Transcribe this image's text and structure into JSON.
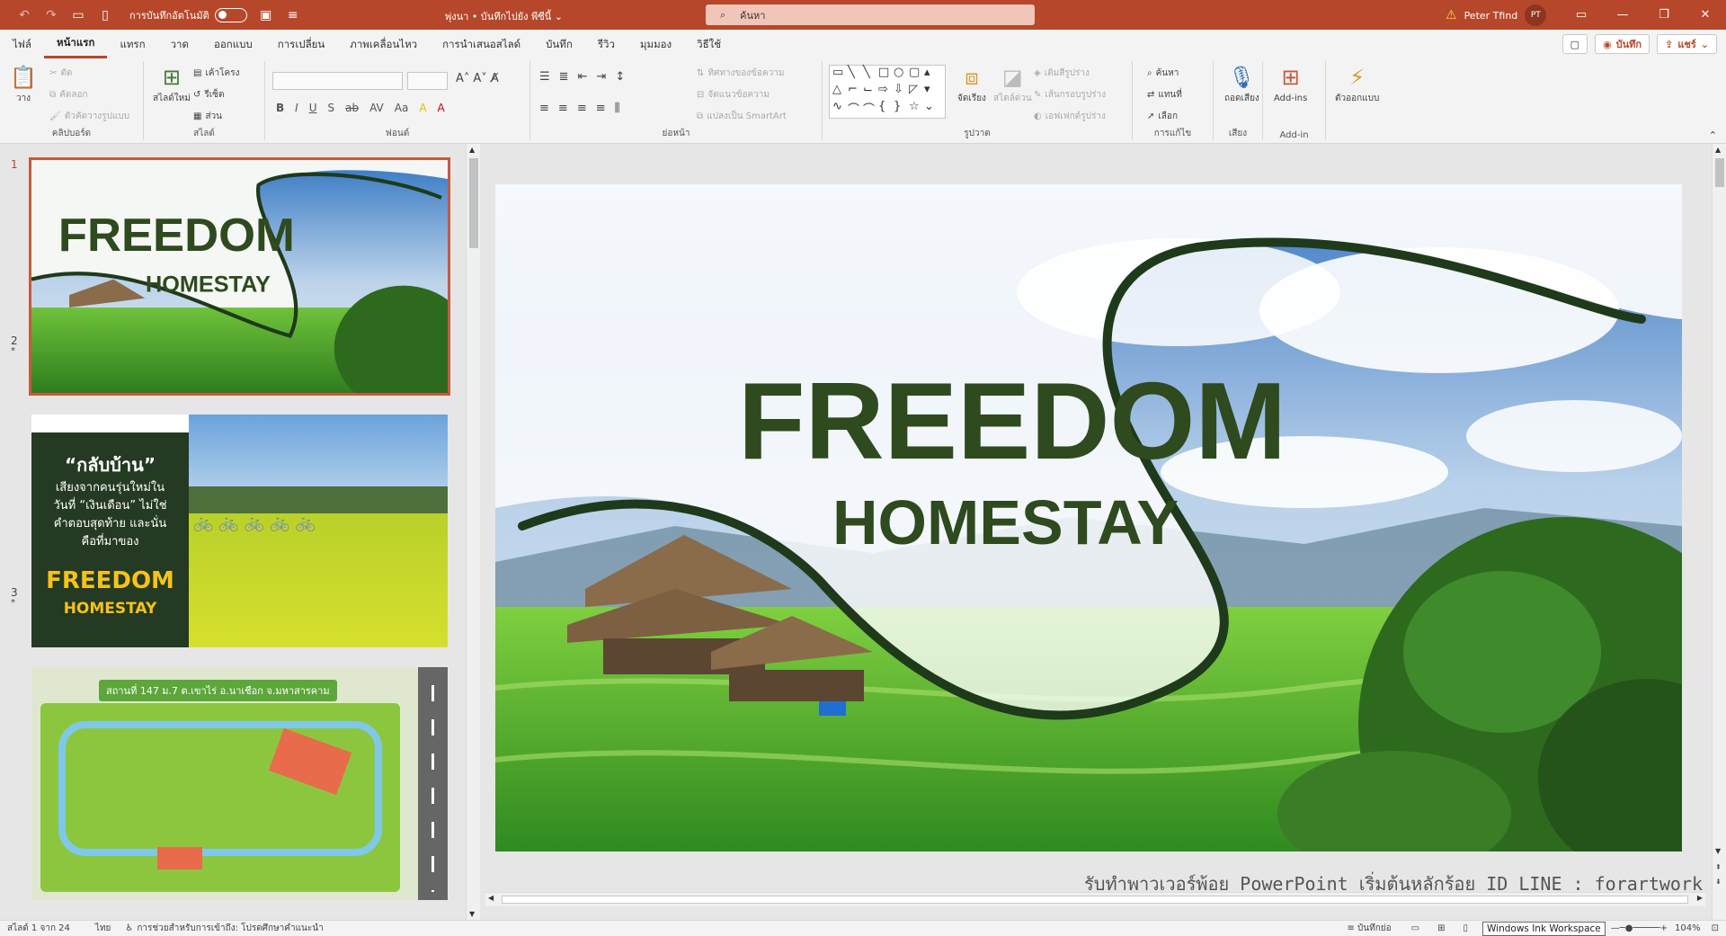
{
  "titlebar": {
    "autosave_label": "การบันทึกอัตโนมัติ",
    "doc_title": "พุ่งนา • บันทึกไปยัง พีซีนี้",
    "search_placeholder": "ค้นหา",
    "user_name": "Peter Tfind",
    "user_initials": "PT"
  },
  "ribbon_tabs": [
    "ไฟล์",
    "หน้าแรก",
    "แทรก",
    "วาด",
    "ออกแบบ",
    "การเปลี่ยน",
    "ภาพเคลื่อนไหว",
    "การนำเสนอสไลด์",
    "บันทึก",
    "รีวิว",
    "มุมมอง",
    "วิธีใช้"
  ],
  "ribbon_right": {
    "record": "บันทึก",
    "share": "แชร์"
  },
  "clipboard": {
    "paste": "วาง",
    "cut": "ตัด",
    "copy": "คัดลอก",
    "format_painter": "ตัวคัดวางรูปแบบ",
    "label": "คลิปบอร์ด"
  },
  "slides_group": {
    "new_slide": "สไลด์ใหม่",
    "layout": "เค้าโครง",
    "reset": "รีเซ็ต",
    "section": "ส่วน",
    "label": "สไลด์"
  },
  "font_group": {
    "label": "ฟอนต์",
    "buttons": [
      "B",
      "I",
      "U",
      "S",
      "ab",
      "AV",
      "Aa",
      "A",
      "A"
    ]
  },
  "paragraph_group": {
    "label": "ย่อหน้า",
    "text_direction": "ทิศทางของข้อความ",
    "align_text": "จัดแนวข้อความ",
    "smartart": "แปลงเป็น SmartArt"
  },
  "drawing_group": {
    "label": "รูปวาด",
    "arrange": "จัดเรียง",
    "quick_styles": "สไตล์ด่วน",
    "shape_fill": "เติมสีรูปร่าง",
    "shape_outline": "เส้นกรอบรูปร่าง",
    "shape_effects": "เอฟเฟกต์รูปร่าง"
  },
  "editing_group": {
    "label": "การแก้ไข",
    "find": "ค้นหา",
    "replace": "แทนที่",
    "select": "เลือก"
  },
  "voice_group": {
    "label": "เสียง",
    "dictate": "ถอดเสียง"
  },
  "addin_group": {
    "label": "Add-in",
    "addins": "Add-ins"
  },
  "designer": {
    "label": "ตัวออกแบบ"
  },
  "slides": [
    {
      "num": "1",
      "title": "FREEDOM",
      "subtitle": "HOMESTAY"
    },
    {
      "num": "2",
      "heading": "“กลับบ้าน”",
      "lines": [
        "เสียงจากคนรุ่นใหม่ใน",
        "วันที่ “เงินเดือน” ไม่ใช่",
        "คำตอบสุดท้าย และนั่น",
        "คือที่มาของ"
      ],
      "brand1": "FREEDOM",
      "brand2": "HOMESTAY"
    },
    {
      "num": "3",
      "location": "สถานที่ 147 ม.7 ต.เขาไร่ อ.นาเชือก จ.มหาสารคาม"
    }
  ],
  "main_slide": {
    "title": "FREEDOM",
    "subtitle": "HOMESTAY"
  },
  "footer_text": "รับทำพาวเวอร์พ้อย PowerPoint เริ่มต้นหลักร้อย ID LINE : forartwork",
  "status": {
    "slide_of": "สไลด์ 1 จาก 24",
    "language": "ไทย",
    "accessibility": "การช่วยสำหรับการเข้าถึง: โปรดศึกษาคำแนะนำ",
    "notes": "บันทึกย่อ",
    "ink_workspace": "Windows Ink Workspace",
    "zoom": "104%"
  },
  "colors": {
    "accent": "#b7472a",
    "title_green": "#2e4a1e",
    "dark_green": "#243a22",
    "slide2_yellow": "#f6c21a"
  }
}
